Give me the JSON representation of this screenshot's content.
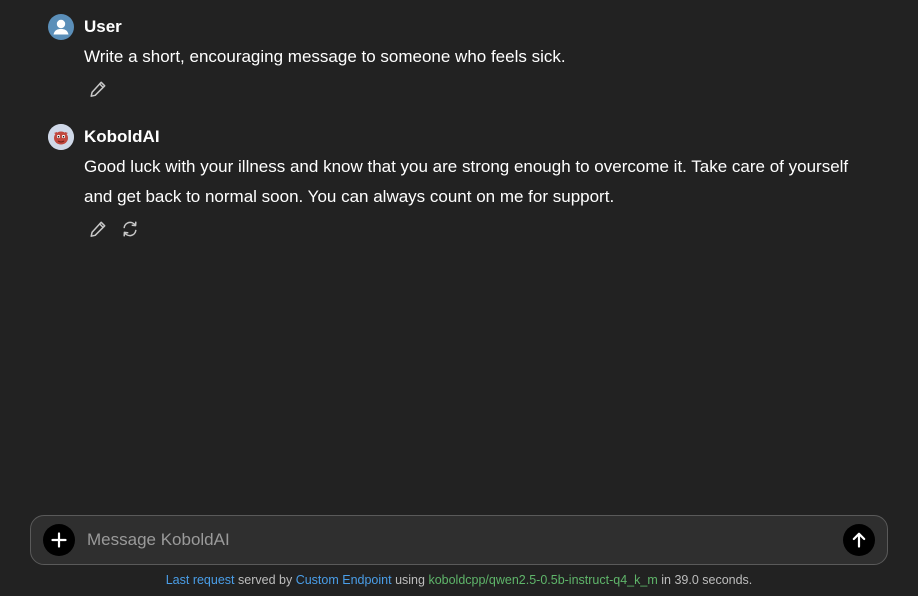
{
  "app": {
    "title": "KoboldAI"
  },
  "messages": [
    {
      "sender": "User",
      "avatar": "user-icon",
      "text": "Write a short, encouraging message to someone who feels sick.",
      "actions": [
        "edit-icon"
      ]
    },
    {
      "sender": "KoboldAI",
      "avatar": "kobold-logo-icon",
      "text": "Good luck with your illness and know that you are strong enough to overcome it. Take care of yourself and get back to normal soon. You can always count on me for support.",
      "actions": [
        "edit-icon",
        "regenerate-icon"
      ]
    }
  ],
  "composer": {
    "placeholder": "Message KoboldAI",
    "value": "",
    "add_icon": "plus-icon",
    "send_icon": "arrow-up-icon"
  },
  "footer": {
    "last_request": "Last request",
    "served_by": "served by",
    "endpoint": "Custom Endpoint",
    "using": "using",
    "model": "koboldcpp/qwen2.5-0.5b-instruct-q4_k_m",
    "in": "in",
    "duration": "39.0 seconds."
  },
  "colors": {
    "background": "#222222",
    "composer_bg": "#2f2f2f",
    "link_blue": "#4a9ee8",
    "model_green": "#5fb56a",
    "user_avatar": "#5b8fb9"
  }
}
